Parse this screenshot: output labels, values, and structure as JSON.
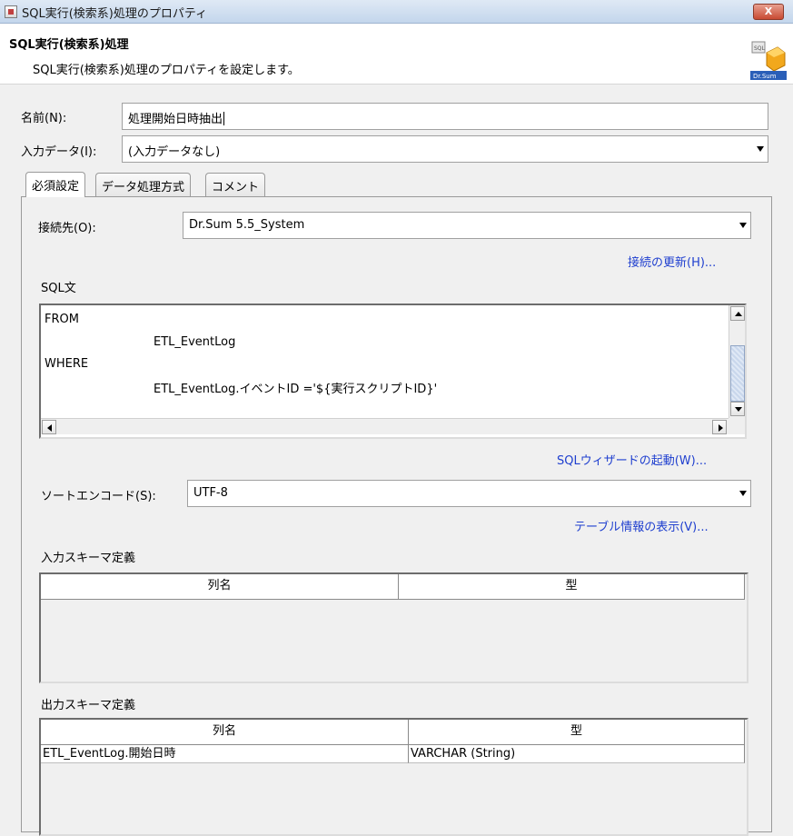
{
  "window": {
    "title": "SQL実行(検索系)処理のプロパティ",
    "close_label": "X"
  },
  "header": {
    "title": "SQL実行(検索系)処理",
    "description": "SQL実行(検索系)処理のプロパティを設定します。",
    "logo_text": "Dr.Sum"
  },
  "form": {
    "name_label": "名前(N):",
    "name_value": "処理開始日時抽出",
    "input_data_label": "入力データ(I):",
    "input_data_value": "(入力データなし)"
  },
  "tabs": [
    {
      "label": "必須設定",
      "active": true
    },
    {
      "label": "データ処理方式",
      "active": false
    },
    {
      "label": "コメント",
      "active": false
    }
  ],
  "required": {
    "connection_label": "接続先(O):",
    "connection_value": "Dr.Sum 5.5_System",
    "refresh_link": "接続の更新(H)...",
    "sql_label": "SQL文",
    "sql_lines": [
      "FROM",
      "ETL_EventLog",
      "WHERE",
      "ETL_EventLog.イベントID ='${実行スクリプトID}'"
    ],
    "sql_wizard_link": "SQLウィザードの起動(W)...",
    "sort_encode_label": "ソートエンコード(S):",
    "sort_encode_value": "UTF-8",
    "table_info_link": "テーブル情報の表示(V)...",
    "input_schema_label": "入力スキーマ定義",
    "input_schema_columns": [
      "列名",
      "型"
    ],
    "output_schema_label": "出力スキーマ定義",
    "output_schema_columns": [
      "列名",
      "型"
    ],
    "output_schema_rows": [
      [
        "ETL_EventLog.開始日時",
        "VARCHAR (String)"
      ]
    ]
  }
}
